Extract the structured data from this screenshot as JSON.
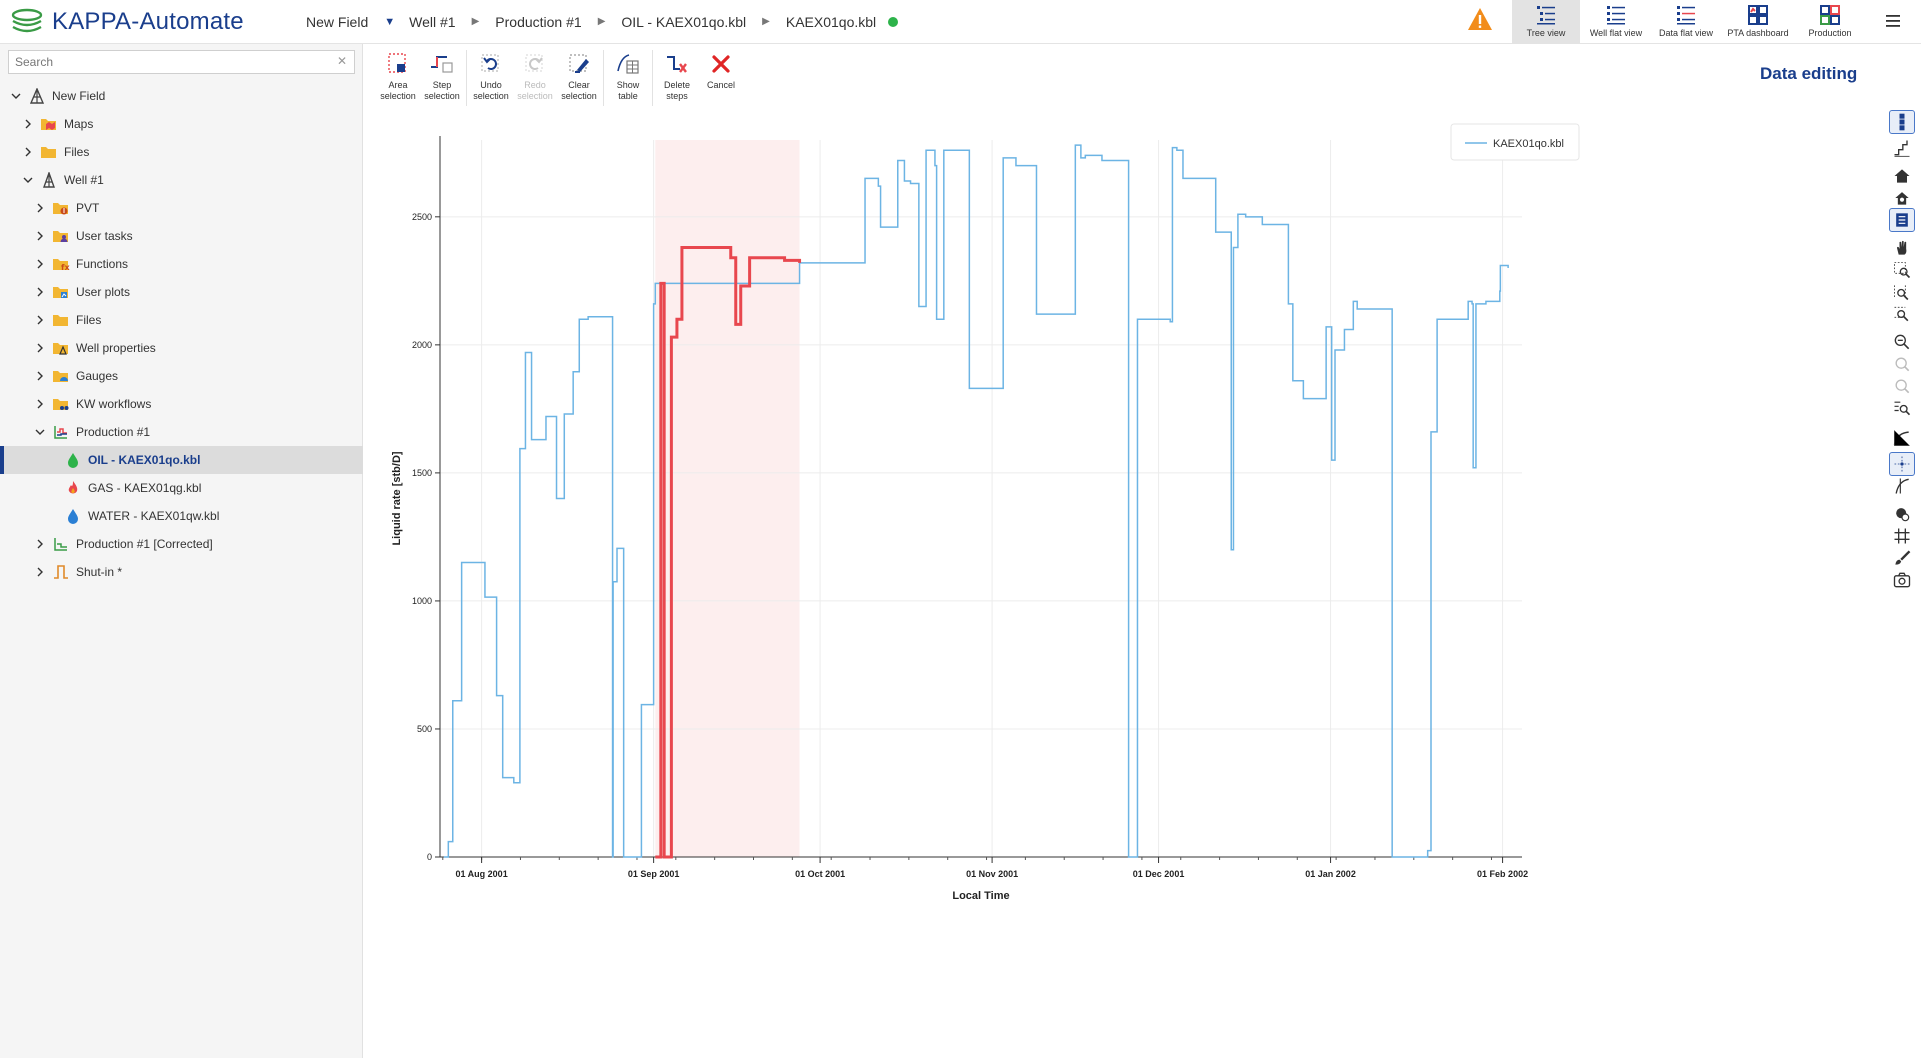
{
  "app": {
    "title": "KAPPA-Automate"
  },
  "breadcrumb": [
    "New Field",
    "Well #1",
    "Production #1",
    "OIL - KAEX01qo.kbl",
    "KAEX01qo.kbl"
  ],
  "views": [
    {
      "label": "Tree view",
      "active": true
    },
    {
      "label": "Well flat view",
      "active": false
    },
    {
      "label": "Data flat view",
      "active": false
    },
    {
      "label": "PTA dashboard",
      "active": false
    },
    {
      "label": "Production",
      "active": false
    }
  ],
  "search": {
    "placeholder": "Search"
  },
  "tree": [
    {
      "label": "New Field",
      "depth": 0,
      "expanded": true,
      "icon": "field-icon"
    },
    {
      "label": "Maps",
      "depth": 1,
      "expanded": false,
      "icon": "maps-folder-icon"
    },
    {
      "label": "Files",
      "depth": 1,
      "expanded": false,
      "icon": "folder-icon"
    },
    {
      "label": "Well #1",
      "depth": 1,
      "expanded": true,
      "icon": "well-icon"
    },
    {
      "label": "PVT",
      "depth": 2,
      "expanded": false,
      "icon": "pvt-folder-icon"
    },
    {
      "label": "User tasks",
      "depth": 2,
      "expanded": false,
      "icon": "user-tasks-folder-icon"
    },
    {
      "label": "Functions",
      "depth": 2,
      "expanded": false,
      "icon": "functions-folder-icon"
    },
    {
      "label": "User plots",
      "depth": 2,
      "expanded": false,
      "icon": "user-plots-folder-icon"
    },
    {
      "label": "Files",
      "depth": 2,
      "expanded": false,
      "icon": "folder-icon"
    },
    {
      "label": "Well properties",
      "depth": 2,
      "expanded": false,
      "icon": "well-properties-folder-icon"
    },
    {
      "label": "Gauges",
      "depth": 2,
      "expanded": false,
      "icon": "gauges-folder-icon"
    },
    {
      "label": "KW workflows",
      "depth": 2,
      "expanded": false,
      "icon": "workflows-folder-icon"
    },
    {
      "label": "Production #1",
      "depth": 2,
      "expanded": true,
      "icon": "production-icon"
    },
    {
      "label": "OIL - KAEX01qo.kbl",
      "depth": 3,
      "leaf": true,
      "selected": true,
      "icon": "oil-drop-icon"
    },
    {
      "label": "GAS - KAEX01qg.kbl",
      "depth": 3,
      "leaf": true,
      "icon": "gas-flame-icon"
    },
    {
      "label": "WATER - KAEX01qw.kbl",
      "depth": 3,
      "leaf": true,
      "icon": "water-drop-icon"
    },
    {
      "label": "Production #1 [Corrected]",
      "depth": 2,
      "expanded": false,
      "icon": "production-corrected-icon"
    },
    {
      "label": "Shut-in *",
      "depth": 2,
      "expanded": false,
      "icon": "shut-in-icon"
    }
  ],
  "toolbar": {
    "area_selection": [
      "Area",
      "selection"
    ],
    "step_selection": [
      "Step",
      "selection"
    ],
    "undo_selection": [
      "Undo",
      "selection"
    ],
    "redo_selection": [
      "Redo",
      "selection"
    ],
    "clear_selection": [
      "Clear",
      "selection"
    ],
    "show_table": [
      "Show",
      "table"
    ],
    "delete_steps": [
      "Delete",
      "steps"
    ],
    "cancel": [
      "Cancel"
    ]
  },
  "panel": {
    "title": "Data editing"
  },
  "colors": {
    "brand": "#1a3e8c",
    "series": "#6cb4e4",
    "selected": "#e8474e",
    "selection_band": "#fdeeee",
    "ok": "#2db34a",
    "warning": "#f28c1a"
  },
  "chart_data": {
    "type": "line",
    "ylabel": "Liquid rate [stb/D]",
    "xlabel": "Local Time",
    "ylim": [
      0,
      2800
    ],
    "yticks": [
      0,
      500,
      1000,
      1500,
      2000,
      2500
    ],
    "xticks": [
      "01 Aug 2001",
      "01 Sep 2001",
      "01 Oct 2001",
      "01 Nov 2001",
      "01 Dec 2001",
      "01 Jan 2002",
      "01 Feb 2002"
    ],
    "xrange_days": [
      -7.5,
      187.5
    ],
    "selection_range_days": [
      31.3,
      57.3
    ],
    "legend": {
      "label": "KAEX01qo.kbl",
      "position": "top-right"
    },
    "series": [
      {
        "name": "KAEX01qo.kbl",
        "x": [
          -6.8,
          -6.0,
          -5.2,
          -3.6,
          -1.5,
          0.6,
          1.8,
          2.7,
          3.8,
          5.8,
          6.9,
          7.9,
          9.0,
          11.6,
          13.5,
          14.9,
          16.5,
          17.6,
          19.2,
          23.6,
          23.7,
          24.4,
          25.6,
          26.0,
          28.8,
          31.0,
          31.3,
          34.5,
          36.6,
          37.5,
          38.8,
          39.2,
          47.1,
          47.7,
          48.4,
          50.4,
          52.4,
          57.3,
          63.0,
          64.0,
          65.0,
          66.2,
          69.1,
          71.5,
          71.9,
          75.0,
          76.2,
          77.3,
          78.8,
          80.1,
          81.7,
          82.0,
          83.3,
          87.9,
          94.0,
          96.3,
          100.0,
          107.0,
          108.0,
          108.8,
          111.8,
          116.6,
          116.8,
          117.8,
          118.2,
          124.1,
          124.5,
          125.3,
          126.4,
          132.3,
          135.1,
          135.5,
          136.3,
          137.7,
          138.3,
          140.7,
          145.4,
          146.2,
          148.1,
          152.2,
          153.2,
          153.8,
          155.5,
          157.1,
          157.8,
          164.1,
          170.5,
          171.1,
          172.2,
          177.8,
          178.5,
          178.7,
          179.2,
          181.0,
          183.5,
          183.6,
          185.0
        ],
        "y": [
          0,
          60,
          610,
          1150,
          1150,
          1015,
          1015,
          630,
          310,
          290,
          1595,
          1970,
          1630,
          1720,
          1400,
          1730,
          1895,
          2100,
          2110,
          0,
          1075,
          1205,
          0,
          0,
          595,
          2160,
          2240,
          2240,
          2240,
          2240,
          2240,
          2240,
          2240,
          2240,
          2240,
          2240,
          2240,
          2320,
          2320,
          2320,
          2320,
          2320,
          2650,
          2620,
          2460,
          2720,
          2640,
          2630,
          2150,
          2760,
          2700,
          2100,
          2760,
          1830,
          2730,
          2700,
          2120,
          2780,
          2730,
          2740,
          2720,
          0,
          0,
          0,
          2100,
          2090,
          2770,
          2760,
          2650,
          2440,
          1200,
          2380,
          2510,
          2500,
          2500,
          2470,
          2160,
          1860,
          1790,
          2070,
          1550,
          1980,
          2060,
          2170,
          2140,
          0,
          25,
          1660,
          2100,
          2170,
          2160,
          1520,
          2160,
          2170,
          2210,
          2310,
          2300
        ],
        "color": "#6cb4e4"
      },
      {
        "name": "KAEX01qo.kbl",
        "x": [
          31.3,
          32.3,
          32.9,
          34.2,
          35.2,
          36.1,
          44.9,
          45.8,
          46.7,
          48.3,
          54.6,
          57.3
        ],
        "y": [
          0,
          2240,
          0,
          2030,
          2100,
          2380,
          2340,
          2080,
          2230,
          2340,
          2330,
          2320
        ],
        "color": "#e8474e"
      }
    ],
    "grid": true
  }
}
